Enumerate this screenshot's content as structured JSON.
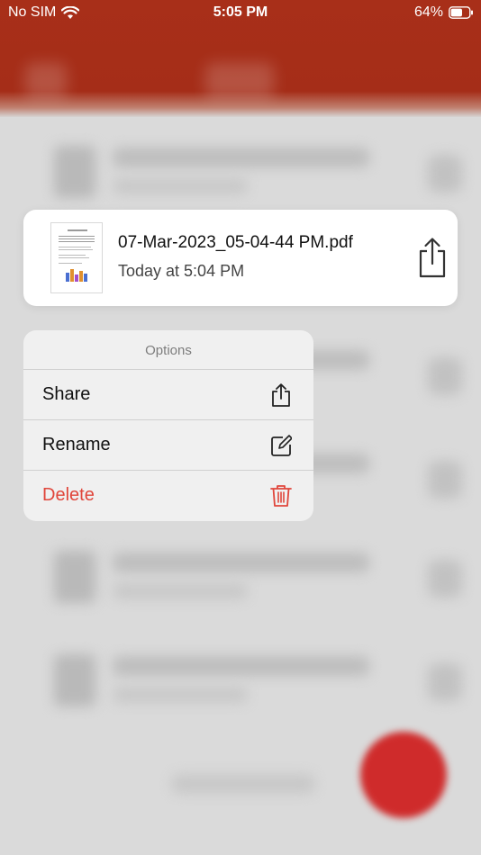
{
  "status_bar": {
    "carrier": "No SIM",
    "time": "5:05 PM",
    "battery": "64%",
    "battery_level": 0.64
  },
  "colors": {
    "brand": "#a52d18",
    "danger": "#e0463b",
    "fab": "#cf2b2b"
  },
  "preview_card": {
    "file_name": "07-Mar-2023_05-04-44 PM.pdf",
    "date": "Today at 5:04 PM",
    "thumbnail_icon": "pdf-page-thumbnail",
    "action_icon": "share-icon"
  },
  "context_menu": {
    "title": "Options",
    "items": [
      {
        "label": "Share",
        "icon": "share-icon"
      },
      {
        "label": "Rename",
        "icon": "edit-icon"
      },
      {
        "label": "Delete",
        "icon": "trash-icon",
        "destructive": true
      }
    ]
  }
}
